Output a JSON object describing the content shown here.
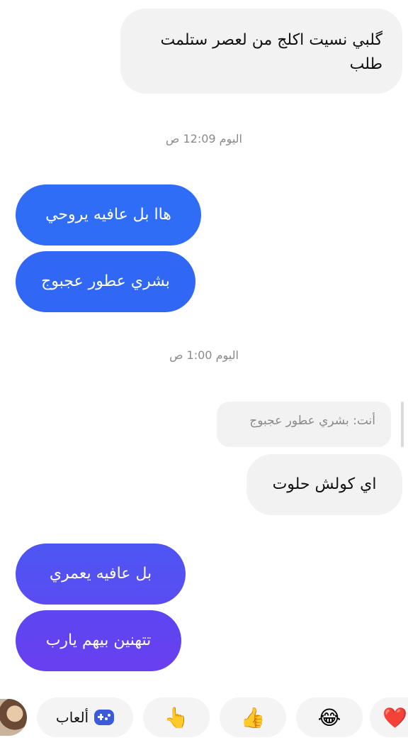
{
  "messages": {
    "m1": "گلبي نسيت اكلج من لعصر ستلمت طلب",
    "ts1": "اليوم 12:09 ص",
    "m2": "هاا بل عافيه يروحي",
    "m3": "بشري عطور عجبوج",
    "ts2": "اليوم 1:00 ص",
    "reply_preview": "أنت: بشري عطور عجبوج",
    "m4": "اي كولش حلوت",
    "m5": "بل عافيه يعمري",
    "m6": "تتهنين بيهم يارب"
  },
  "quick_reactions": {
    "heart": "❤️",
    "laugh": "😂",
    "thumbs_up": "👍",
    "pointing_hand": "👆",
    "games_label": "ألعاب",
    "games_icon": "gamepad-icon"
  },
  "colors": {
    "sent_top": "#2f6df6",
    "sent_bottom": "#6a3ff0",
    "received_bg": "#f2f2f2"
  }
}
